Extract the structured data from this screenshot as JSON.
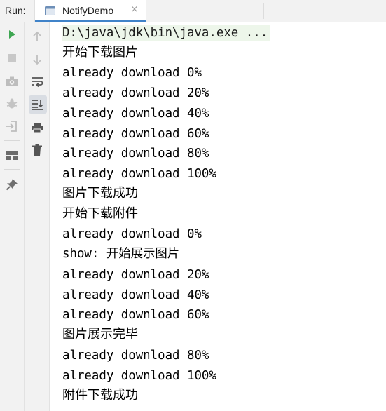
{
  "header": {
    "run_label": "Run:",
    "tab_title": "NotifyDemo",
    "tab_icon": "console-tab-icon",
    "close_glyph": "×"
  },
  "toolbar_primary": [
    "run-icon",
    "stop-icon",
    "camera-icon",
    "debug-bug-icon",
    "login-icon",
    "layout-icon",
    "pin-icon"
  ],
  "toolbar_secondary": [
    "arrow-up-icon",
    "arrow-down-icon",
    "soft-wrap-icon",
    "scroll-to-end-icon",
    "print-icon",
    "trash-icon"
  ],
  "colors": {
    "accent": "#4083c9",
    "run_green": "#3ea652",
    "command_highlight": "#edf6ea",
    "panel_bg": "#f2f2f2"
  },
  "console": {
    "command": "D:\\java\\jdk\\bin\\java.exe ...",
    "lines": [
      "开始下载图片",
      "already download 0%",
      "already download 20%",
      "already download 40%",
      "already download 60%",
      "already download 80%",
      "already download 100%",
      "图片下载成功",
      "开始下载附件",
      "already download 0%",
      "show: 开始展示图片",
      "already download 20%",
      "already download 40%",
      "already download 60%",
      "图片展示完毕",
      "already download 80%",
      "already download 100%",
      "附件下载成功"
    ]
  }
}
